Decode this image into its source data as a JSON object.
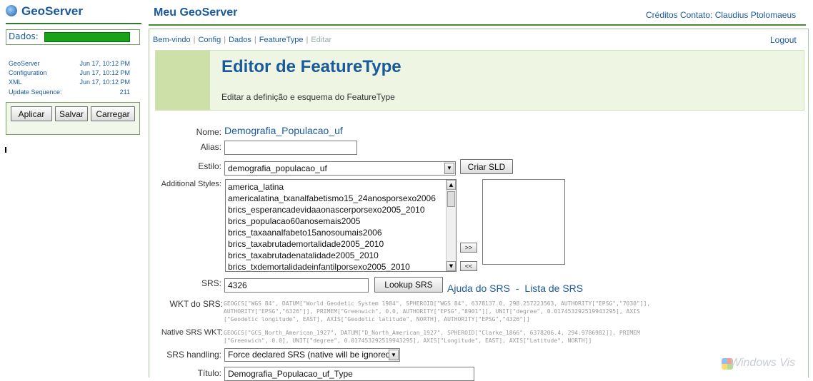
{
  "sidebar": {
    "logo": "GeoServer",
    "dados_label": "Dados:",
    "stats": [
      {
        "name": "GeoServer",
        "value": "Jun 17, 10:12 PM"
      },
      {
        "name": "Configuration",
        "value": "Jun 17, 10:12 PM"
      },
      {
        "name": "XML",
        "value": "Jun 17, 10:12 PM"
      },
      {
        "name": "Update Sequence:",
        "value": "211"
      }
    ],
    "buttons": {
      "apply": "Aplicar",
      "save": "Salvar",
      "load": "Carregar"
    }
  },
  "header": {
    "title": "Meu GeoServer",
    "credits": "Créditos Contato: Claudius Ptolomaeus"
  },
  "nav": {
    "breadcrumb": [
      "Bem-vindo",
      "Config",
      "Dados",
      "FeatureType",
      "Editar"
    ],
    "logout": "Logout"
  },
  "banner": {
    "title": "Editor de FeatureType",
    "subtitle": "Editar a definição e esquema do FeatureType"
  },
  "form": {
    "name_label": "Nome:",
    "name_value": "Demografia_Populacao_uf",
    "alias_label": "Alias:",
    "alias_value": "",
    "style_label": "Estilo:",
    "style_value": "demografia_populacao_uf",
    "create_sld": "Criar SLD",
    "additional_styles_label": "Additional Styles:",
    "additional_styles": [
      "america_latina",
      "americalatina_txanalfabetismo15_24anosporsexo2006",
      "brics_esperancadevidaaonascerporsexo2005_2010",
      "brics_populacao60anosemais2005",
      "brics_taxaanalfabeto15anosoumais2006",
      "brics_taxabrutademortalidade2005_2010",
      "brics_taxabrutadenatalidade2005_2010",
      "brics_txdemortalidadeinfantilporsexo2005_2010"
    ],
    "move_right": ">>",
    "move_left": "<<",
    "srs_label": "SRS:",
    "srs_value": "4326",
    "lookup_srs": "Lookup SRS",
    "srs_help": "Ajuda do SRS",
    "srs_dash": "-",
    "srs_list": "Lista de SRS",
    "wkt_label": "WKT do SRS:",
    "wkt_lines": [
      "GEOGCS[\"WGS 84\", DATUM[\"World Geodetic System 1984\", SPHEROID[\"WGS 84\", 6378137.0, 298.257223563, AUTHORITY[\"EPSG\",\"7030\"]],",
      "AUTHORITY[\"EPSG\",\"6326\"]], PRIMEM[\"Greenwich\", 0.0, AUTHORITY[\"EPSG\",\"8901\"]], UNIT[\"degree\", 0.017453292519943295], AXIS",
      "[\"Geodetic longitude\", EAST], AXIS[\"Geodetic latitude\", NORTH], AUTHORITY[\"EPSG\",\"4326\"]]"
    ],
    "native_wkt_label": "Native SRS WKT:",
    "native_wkt_lines": [
      "GEOGCS[\"GCS_North_American_1927\", DATUM[\"D_North_American_1927\", SPHEROID[\"Clarke_1866\", 6378206.4, 294.9786982]], PRIMEM",
      "[\"Greenwich\", 0.0], UNIT[\"degree\", 0.017453292519943295], AXIS[\"Longitude\", EAST], AXIS[\"Latitude\", NORTH]]"
    ],
    "srs_handling_label": "SRS handling:",
    "srs_handling_value": "Force declared SRS (native will be ignored)",
    "title_label": "Título:",
    "title_value": "Demografia_Populacao_uf_Type"
  },
  "os_watermark": "Windows Vis",
  "colors": {
    "brand_blue": "#1a5a9c",
    "progress_green": "#17a317",
    "banner_bg": "#eef6e3"
  }
}
